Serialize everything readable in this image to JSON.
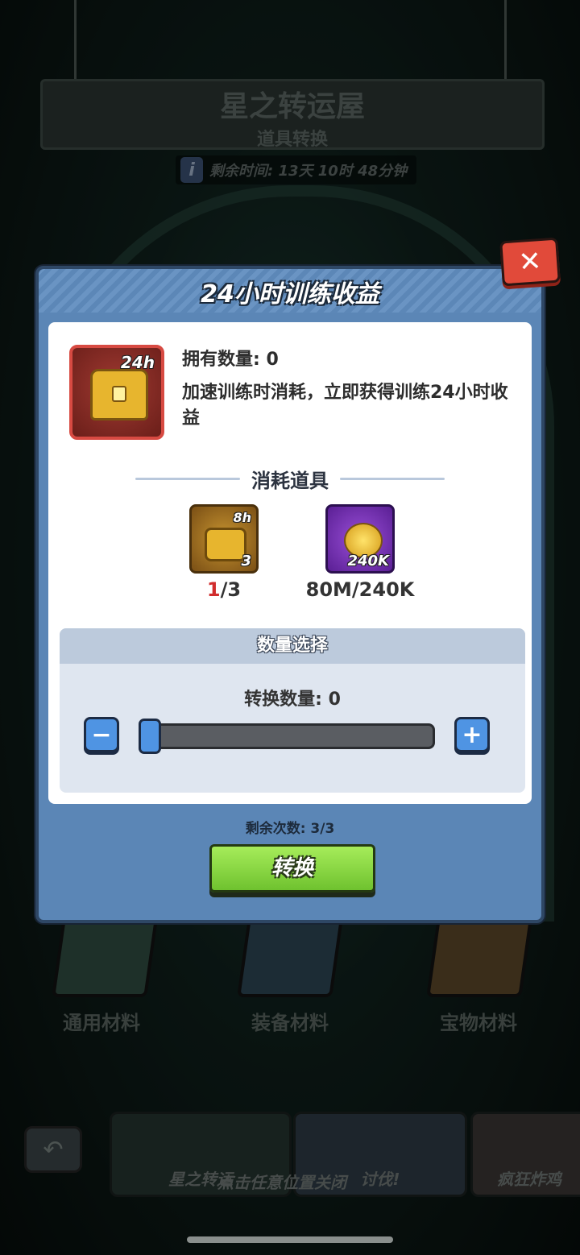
{
  "background": {
    "shop_title": "星之转运屋",
    "shop_subtitle": "道具转换",
    "timer_text": "剩余时间: 13天 10时 48分钟",
    "categories": [
      "通用材料",
      "装备材料",
      "宝物材料"
    ],
    "bottom_cards": [
      "星之转运",
      "点击任意位置关闭",
      "讨伐!",
      "疯狂炸鸡"
    ]
  },
  "modal": {
    "title": "24小时训练收益",
    "item_badge": "24h",
    "owned_label": "拥有数量: 0",
    "description": "加速训练时消耗，立即获得训练24小时收益",
    "consume_title": "消耗道具",
    "costs": [
      {
        "icon": "chest-8h-icon",
        "badge": "8h",
        "count": "3",
        "have": "1",
        "need": "/3"
      },
      {
        "icon": "gold-coins-icon",
        "badge": "240K",
        "label": "80M/240K"
      }
    ],
    "quantity_header": "数量选择",
    "quantity_label": "转换数量: 0",
    "slider_value": 0,
    "minus_symbol": "−",
    "plus_symbol": "+",
    "remaining_text": "剩余次数: 3/3",
    "convert_label": "转换",
    "close_symbol": "✕"
  },
  "colors": {
    "modal_blue": "#5b86b6",
    "button_green": "#8ad647",
    "close_red": "#e14a3a"
  }
}
